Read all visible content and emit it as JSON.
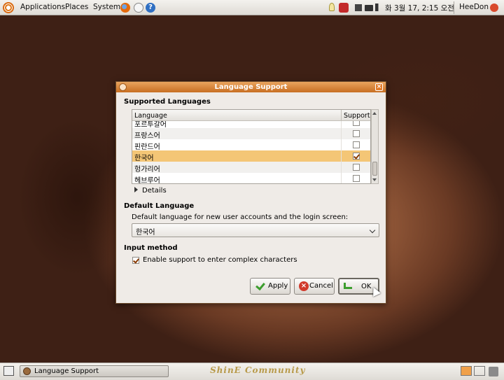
{
  "top_panel": {
    "menus": [
      "Applications",
      "Places",
      "System"
    ],
    "clock": "화  3월 17,  2:15 오전",
    "user": "HeeDon"
  },
  "window": {
    "title": "Language Support",
    "supported_languages_heading": "Supported Languages",
    "table": {
      "col_language": "Language",
      "col_support": "Support",
      "rows": [
        {
          "name": "포르투갈어",
          "support": false,
          "selected": false
        },
        {
          "name": "프랑스어",
          "support": false,
          "selected": false
        },
        {
          "name": "핀란드어",
          "support": false,
          "selected": false
        },
        {
          "name": "한국어",
          "support": true,
          "selected": true
        },
        {
          "name": "헝가리어",
          "support": false,
          "selected": false
        },
        {
          "name": "헤브루어",
          "support": false,
          "selected": false
        }
      ]
    },
    "details_label": "Details",
    "default_language_heading": "Default Language",
    "default_language_description": "Default language for new user accounts and the login screen:",
    "default_language_value": "한국어",
    "input_method_heading": "Input method",
    "complex_chars_label": "Enable support to enter complex characters",
    "complex_chars_checked": true,
    "buttons": {
      "apply": "Apply",
      "cancel": "Cancel",
      "ok": "OK"
    }
  },
  "bottom_panel": {
    "task_label": "Language Support",
    "watermark": "ShinE Community"
  },
  "colors": {
    "titlebar": "#d9853a",
    "selection": "#f4c676",
    "panel": "#e8e5e0"
  }
}
